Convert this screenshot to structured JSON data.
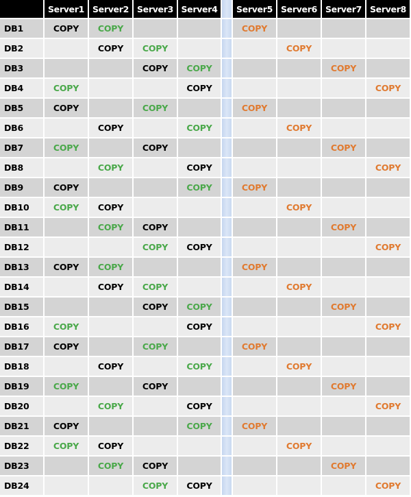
{
  "colors": {
    "header_bg": "#000000",
    "header_text": "#ffffff",
    "row_odd_bg": "#d4d4d4",
    "row_even_bg": "#ececec",
    "separator": "#c5d6ef",
    "primary_copy": "#000000",
    "secondary_copy": "#4aa84a",
    "remote_copy": "#e07a30"
  },
  "table": {
    "columns": [
      "Server1",
      "Server2",
      "Server3",
      "Server4",
      "",
      "Server5",
      "Server6",
      "Server7",
      "Server8"
    ],
    "copy_label": "COPY",
    "rows": [
      {
        "db": "DB1",
        "cells": [
          "black",
          "green",
          "",
          "",
          "",
          "orange",
          "",
          "",
          ""
        ]
      },
      {
        "db": "DB2",
        "cells": [
          "",
          "black",
          "green",
          "",
          "",
          "",
          "orange",
          "",
          ""
        ]
      },
      {
        "db": "DB3",
        "cells": [
          "",
          "",
          "black",
          "green",
          "",
          "",
          "",
          "orange",
          ""
        ]
      },
      {
        "db": "DB4",
        "cells": [
          "green",
          "",
          "",
          "black",
          "",
          "",
          "",
          "",
          "orange"
        ]
      },
      {
        "db": "DB5",
        "cells": [
          "black",
          "",
          "green",
          "",
          "",
          "orange",
          "",
          "",
          ""
        ]
      },
      {
        "db": "DB6",
        "cells": [
          "",
          "black",
          "",
          "green",
          "",
          "",
          "orange",
          "",
          ""
        ]
      },
      {
        "db": "DB7",
        "cells": [
          "green",
          "",
          "black",
          "",
          "",
          "",
          "",
          "orange",
          ""
        ]
      },
      {
        "db": "DB8",
        "cells": [
          "",
          "green",
          "",
          "black",
          "",
          "",
          "",
          "",
          "orange"
        ]
      },
      {
        "db": "DB9",
        "cells": [
          "black",
          "",
          "",
          "green",
          "",
          "orange",
          "",
          "",
          ""
        ]
      },
      {
        "db": "DB10",
        "cells": [
          "green",
          "black",
          "",
          "",
          "",
          "",
          "orange",
          "",
          ""
        ]
      },
      {
        "db": "DB11",
        "cells": [
          "",
          "green",
          "black",
          "",
          "",
          "",
          "",
          "orange",
          ""
        ]
      },
      {
        "db": "DB12",
        "cells": [
          "",
          "",
          "green",
          "black",
          "",
          "",
          "",
          "",
          "orange"
        ]
      },
      {
        "db": "DB13",
        "cells": [
          "black",
          "green",
          "",
          "",
          "",
          "orange",
          "",
          "",
          ""
        ]
      },
      {
        "db": "DB14",
        "cells": [
          "",
          "black",
          "green",
          "",
          "",
          "",
          "orange",
          "",
          ""
        ]
      },
      {
        "db": "DB15",
        "cells": [
          "",
          "",
          "black",
          "green",
          "",
          "",
          "",
          "orange",
          ""
        ]
      },
      {
        "db": "DB16",
        "cells": [
          "green",
          "",
          "",
          "black",
          "",
          "",
          "",
          "",
          "orange"
        ]
      },
      {
        "db": "DB17",
        "cells": [
          "black",
          "",
          "green",
          "",
          "",
          "orange",
          "",
          "",
          ""
        ]
      },
      {
        "db": "DB18",
        "cells": [
          "",
          "black",
          "",
          "green",
          "",
          "",
          "orange",
          "",
          ""
        ]
      },
      {
        "db": "DB19",
        "cells": [
          "green",
          "",
          "black",
          "",
          "",
          "",
          "",
          "orange",
          ""
        ]
      },
      {
        "db": "DB20",
        "cells": [
          "",
          "green",
          "",
          "black",
          "",
          "",
          "",
          "",
          "orange"
        ]
      },
      {
        "db": "DB21",
        "cells": [
          "black",
          "",
          "",
          "green",
          "",
          "orange",
          "",
          "",
          ""
        ]
      },
      {
        "db": "DB22",
        "cells": [
          "green",
          "black",
          "",
          "",
          "",
          "",
          "orange",
          "",
          ""
        ]
      },
      {
        "db": "DB23",
        "cells": [
          "",
          "green",
          "black",
          "",
          "",
          "",
          "",
          "orange",
          ""
        ]
      },
      {
        "db": "DB24",
        "cells": [
          "",
          "",
          "green",
          "black",
          "",
          "",
          "",
          "",
          "orange"
        ]
      }
    ]
  }
}
